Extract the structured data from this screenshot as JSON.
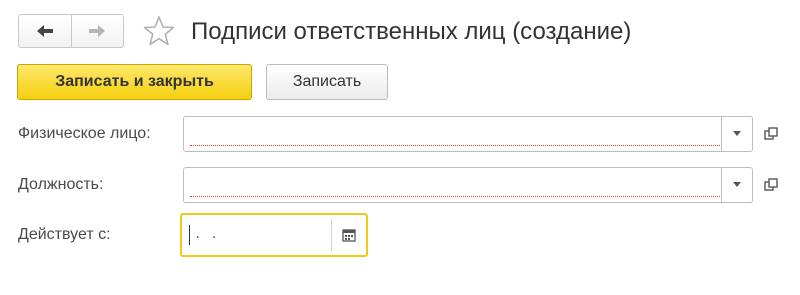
{
  "window": {
    "title": "Подписи ответственных лиц (создание)"
  },
  "navigation": {
    "back_icon": "arrow-left-icon",
    "forward_icon": "arrow-right-icon",
    "favorite_icon": "star-icon"
  },
  "toolbar": {
    "save_close_label": "Записать и закрыть",
    "save_label": "Записать"
  },
  "form": {
    "person": {
      "label": "Физическое лицо:",
      "value": ""
    },
    "position": {
      "label": "Должность:",
      "value": ""
    },
    "valid_from": {
      "label": "Действует с:",
      "value": " .  ."
    }
  },
  "colors": {
    "primary_button": "#f5cf0f",
    "required_underline": "#e03b3b",
    "focus_border": "#f2c81a"
  }
}
